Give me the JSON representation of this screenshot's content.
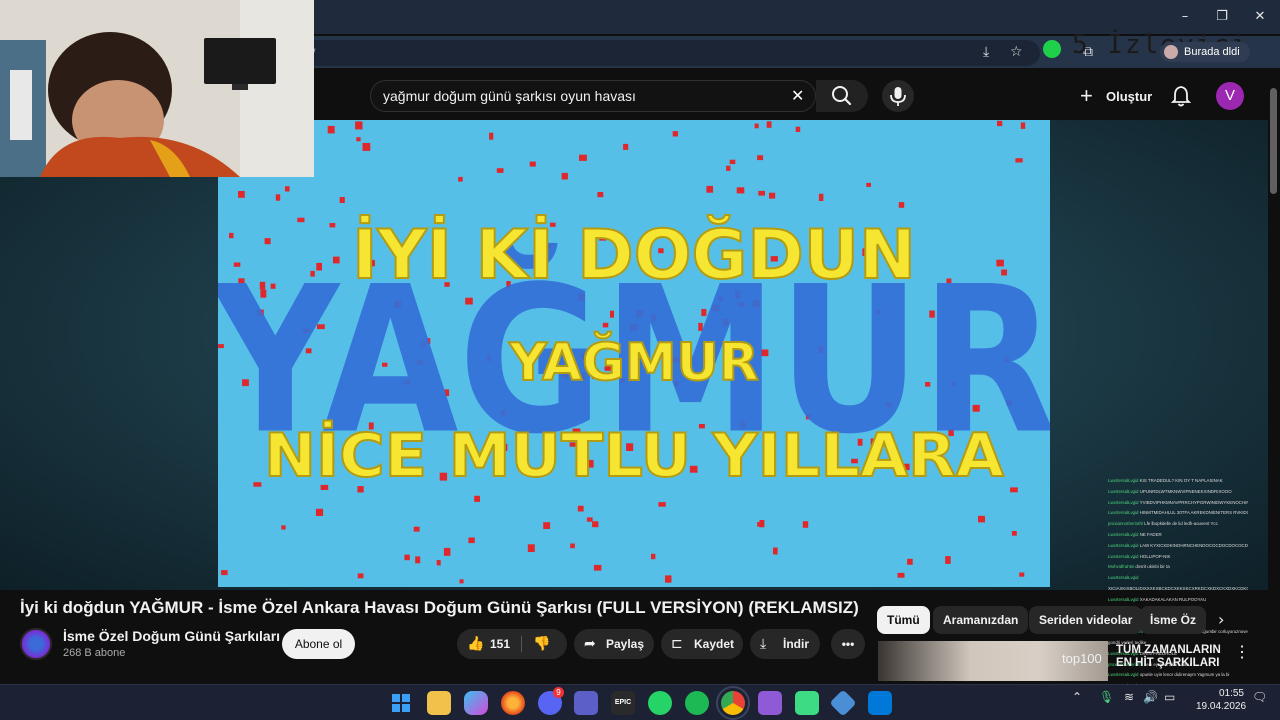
{
  "window": {
    "minimize_glyph": "–",
    "maximize_glyph": "❐",
    "close_glyph": "✕"
  },
  "browser": {
    "address_fragment": "/",
    "watermark": "5 İzleyici",
    "profile_chip": "Burada dldi"
  },
  "youtube": {
    "search_query": "yağmur doğum günü şarkısı oyun havası",
    "create_label": "Oluştur",
    "avatar_letter": "V"
  },
  "video_frame": {
    "line1": "İYİ Kİ DOĞDUN",
    "background_name": "YAĞMUR",
    "line2": "YAĞMUR",
    "line3": "NİCE MUTLU YILLARA"
  },
  "video": {
    "title": "İyi ki doğdun YAĞMUR - İsme Özel Ankara Havası Doğum Günü Şarkısı (FULL VERSİYON) (REKLAMSIZ)",
    "channel_name": "İsme Özel Doğum Günü Şarkıları",
    "subscribers": "268 B abone",
    "subscribe_label": "Abone ol",
    "like_count": "151",
    "share_label": "Paylaş",
    "save_label": "Kaydet",
    "download_label": "İndir"
  },
  "chips": [
    "Tümü",
    "Aramanızdan",
    "Seriden videolar",
    "İsme Öz"
  ],
  "recommendation": {
    "overlay_label": "top100",
    "title": "TÜM ZAMANLARIN EN HİT ŞARKILARI"
  },
  "chat_lines": [
    {
      "u": "LwxrtersalLvgid",
      "t": "KIS TRADEDUL? KIN OY T NAPLASINAK"
    },
    {
      "u": "LwxrtersalLvgid",
      "t": "UPUNRDLWTMKNWVIPNENEKXINDRIXOOO"
    },
    {
      "u": "LwxrtersalLvgid",
      "t": "YVIBDVIPHKMNAVPRRCHYPGRWINIDWYKENOCHINY"
    },
    {
      "u": "LwxrtersalLvgid",
      "t": "HINMTMIDAHLUL 30TFA AKREKDNIENITERS RVKIDOSLM GUNU VERSIYULICOTUN"
    },
    {
      "u": "proxiannotheriothl",
      "t": "Lfe lbopkitelle de lid ledh-aouvent Ycc"
    },
    {
      "u": "LwxrtersalLvgid",
      "t": "NE FADER"
    },
    {
      "u": "LwxrtersalLvgid",
      "t": "LAW KYXICKDKINOHRNCHENDOCOCDOCDOCOCDOCO"
    },
    {
      "u": "LwxrtersalLvgid",
      "t": "HOLLIPOP-NIK"
    },
    {
      "u": "Mohvidfrahtis",
      "t": "dnsrit ukinbi bir ta"
    },
    {
      "u": "LwxrtersalLvgid",
      "t": ""
    },
    {
      "u": "",
      "t": "XICIAXKIXBOLIDIXXXKXBCKDCXKKSKCXRKDCXKDXCKXDXKCDKOKXDXDCKD"
    },
    {
      "u": "LwxrtersalLvgid",
      "t": "XAKADAKALAKAN RULPOOYAU"
    },
    {
      "u": "Mohvidfrahtis",
      "t": "zergi simi eni aznai"
    },
    {
      "u": "LwxrtersalLvgid",
      "t": "YAGMUR ODM"
    },
    {
      "u": "proxiannotheriothl",
      "t": "bo eyndoo yopr dir video lili doğumbir corluyoruznoventr"
    },
    {
      "u": "",
      "t": "gondri verleri tedike"
    },
    {
      "u": "LwxrtersalLvgid",
      "t": "DIRIN PREDROLE"
    },
    {
      "u": "proxiannotheriothl",
      "t": "seni eyroncr akam nasur"
    },
    {
      "u": "LwxrtersalLvgid",
      "t": "opunle uyin lenor dulirenaym Yagmum ya la bi"
    },
    {
      "u": "",
      "t": "varsnz vai ennimum"
    }
  ],
  "taskbar": {
    "time": "01:55",
    "date": "19.04.2026",
    "discord_badge": "9",
    "epic_label": "EPIC",
    "apps": [
      "windows-start",
      "file-explorer",
      "copilot",
      "firefox",
      "discord",
      "teams",
      "epic-games",
      "whatsapp",
      "spotify",
      "chrome",
      "visual-studio",
      "android-studio",
      "network-tool",
      "vscode"
    ]
  },
  "colors": {
    "video_sky": "#56bfe8",
    "title_yellow": "#f7e631",
    "name_blue": "#3470d8",
    "confetti_red": "#e0282c",
    "accent_green": "#1fd14a",
    "avatar_purple": "#9c27b0"
  }
}
